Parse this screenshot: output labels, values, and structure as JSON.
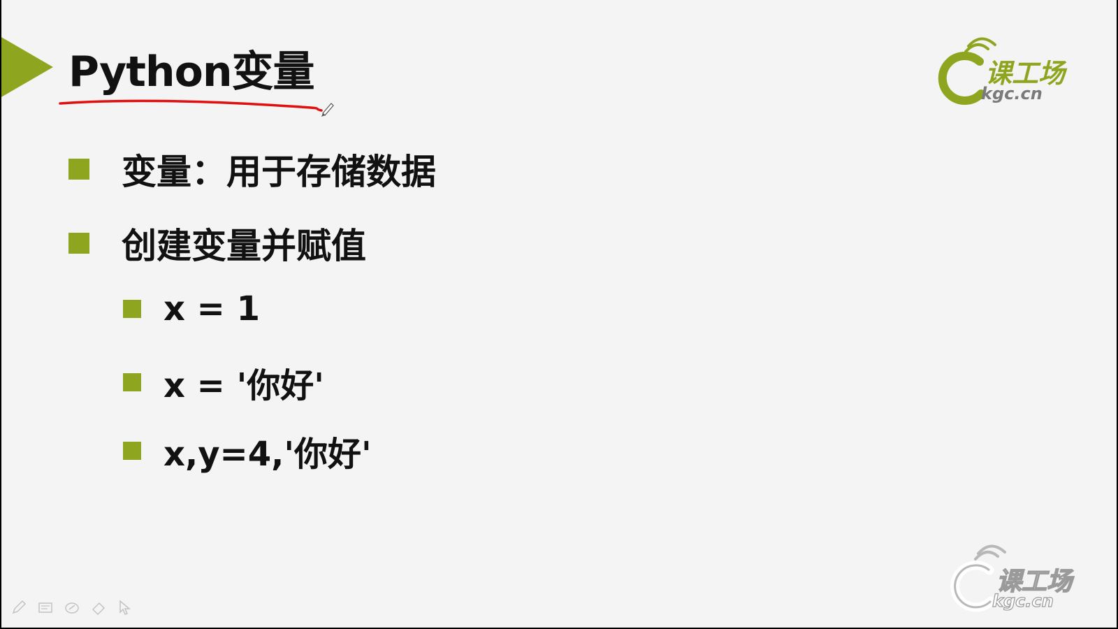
{
  "slide": {
    "title": "Python变量",
    "bullets": [
      {
        "text": "变量：用于存储数据"
      },
      {
        "text": "创建变量并赋值"
      }
    ],
    "sub_bullets": [
      {
        "text": "x = 1"
      },
      {
        "text": "x = '你好'"
      },
      {
        "text": "x,y=4,'你好'"
      }
    ],
    "logo": {
      "brand_cn": "课工场",
      "domain": "kgc.cn"
    },
    "watermark": {
      "brand_cn": "课工场",
      "domain": "kgc.cn"
    }
  },
  "toolbar": {
    "tools": [
      {
        "icon": "pen-icon"
      },
      {
        "icon": "slides-icon"
      },
      {
        "icon": "highlighter-icon"
      },
      {
        "icon": "eraser-icon"
      },
      {
        "icon": "pointer-icon"
      }
    ]
  },
  "colors": {
    "accent_green": "#8ea61f",
    "annotation_red": "#e01010",
    "background": "#f4f4f4",
    "text": "#111111"
  }
}
